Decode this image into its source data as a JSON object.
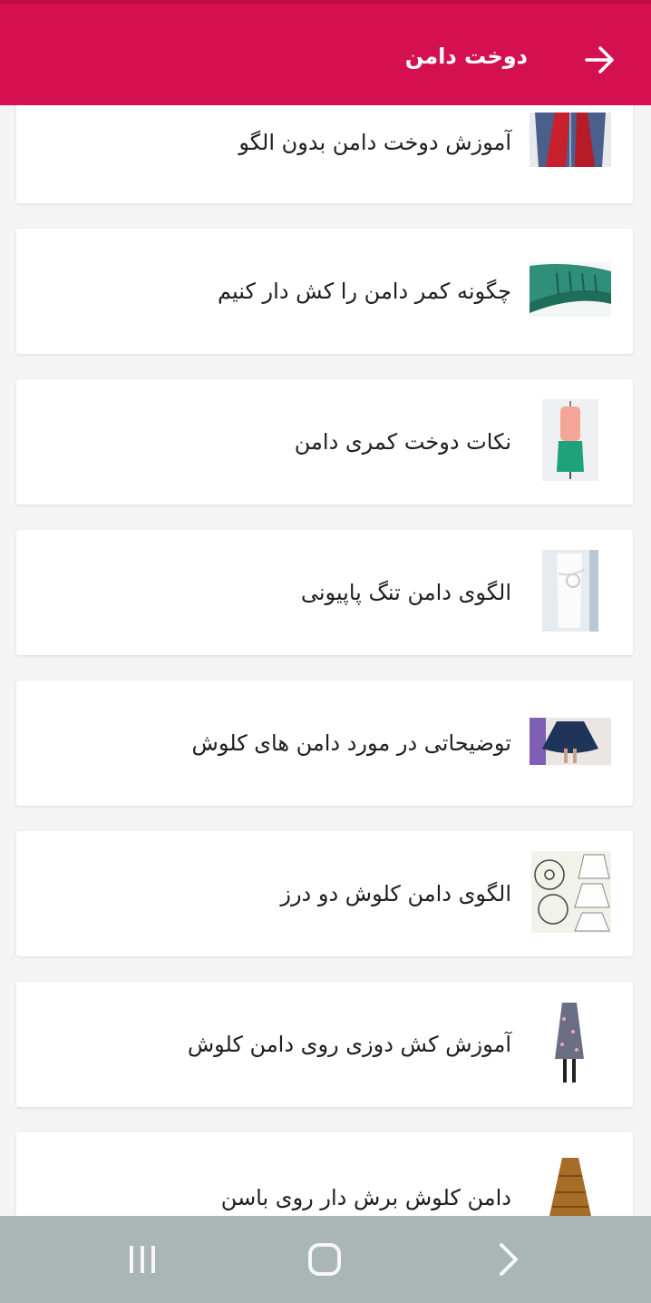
{
  "header": {
    "title": "دوخت دامن",
    "back_icon": "arrow-right-icon"
  },
  "items": [
    {
      "title": "آموزش دوخت دامن بدون الگو"
    },
    {
      "title": "چگونه کمر دامن را کش دار کنیم"
    },
    {
      "title": "نکات دوخت کمری دامن"
    },
    {
      "title": "الگوی دامن تنگ پاپیونی"
    },
    {
      "title": "توضیحاتی در مورد دامن های کلوش"
    },
    {
      "title": "الگوی دامن کلوش دو درز"
    },
    {
      "title": "آموزش کش دوزی روی دامن کلوش"
    },
    {
      "title": "دامن کلوش برش دار روی باسن"
    }
  ],
  "nav": {
    "recents_icon": "recent-apps-icon",
    "home_icon": "home-icon",
    "back_icon": "back-chevron-icon"
  },
  "colors": {
    "header": "#d41050",
    "background": "#f4f4f4",
    "navbar": "#aab5b5"
  }
}
